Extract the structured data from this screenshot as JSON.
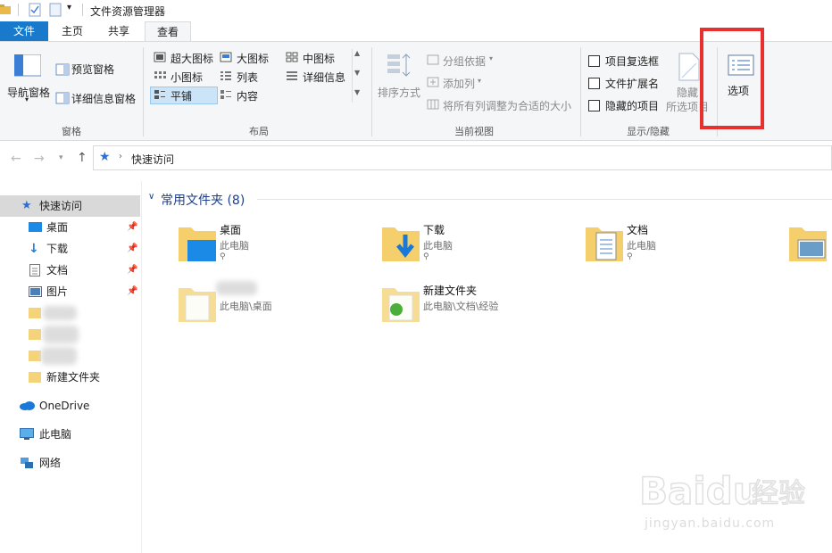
{
  "window": {
    "title": "文件资源管理器"
  },
  "tabs": [
    {
      "label": "文件"
    },
    {
      "label": "主页"
    },
    {
      "label": "共享"
    },
    {
      "label": "查看"
    }
  ],
  "ribbon": {
    "panes": {
      "nav_pane": "导航窗格",
      "preview_pane": "预览窗格",
      "details_pane": "详细信息窗格",
      "group": "窗格"
    },
    "layout": {
      "items": [
        "超大图标",
        "大图标",
        "中图标",
        "小图标",
        "列表",
        "详细信息",
        "平铺",
        "内容"
      ],
      "selected": "平铺",
      "group": "布局"
    },
    "current_view": {
      "sort": "排序方式",
      "group_by": "分组依据",
      "add_column": "添加列",
      "fit_columns": "将所有列调整为合适的大小",
      "group": "当前视图"
    },
    "show_hide": {
      "item_checkboxes": "项目复选框",
      "file_extensions": "文件扩展名",
      "hidden_items": "隐藏的项目",
      "hide_selected": "隐藏",
      "hide_selected_2": "所选项目",
      "group": "显示/隐藏"
    },
    "options": {
      "label": "选项"
    },
    "highlight_color": "#e8312f"
  },
  "address": {
    "path": "快速访问"
  },
  "sidebar": {
    "quick_access": "快速访问",
    "items": [
      {
        "label": "桌面"
      },
      {
        "label": "下载"
      },
      {
        "label": "文档"
      },
      {
        "label": "图片"
      },
      {
        "label": ""
      },
      {
        "label": ""
      },
      {
        "label": ""
      },
      {
        "label": "新建文件夹"
      }
    ],
    "onedrive": "OneDrive",
    "this_pc": "此电脑",
    "network": "网络"
  },
  "main": {
    "section_title": "常用文件夹 (8)",
    "folders": [
      {
        "name": "桌面",
        "path": "此电脑"
      },
      {
        "name": "下载",
        "path": "此电脑"
      },
      {
        "name": "文档",
        "path": "此电脑"
      },
      {
        "name": "",
        "path": "此电脑\\桌面"
      },
      {
        "name": "新建文件夹",
        "path": "此电脑\\文档\\经验"
      }
    ]
  },
  "watermark": {
    "text": "jingyan.baidu.com"
  }
}
